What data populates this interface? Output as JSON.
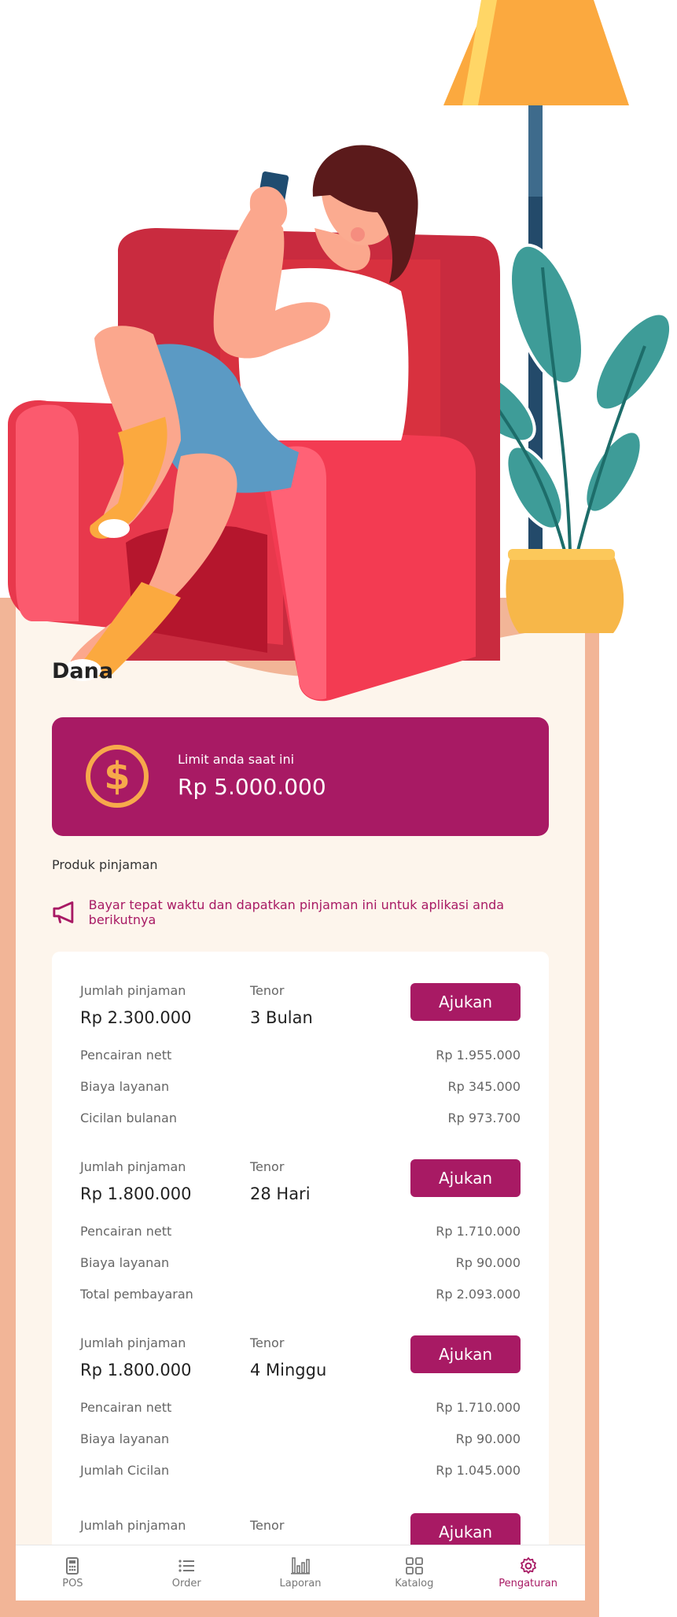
{
  "page": {
    "title": "Dana"
  },
  "limit": {
    "label": "Limit anda saat ini",
    "value": "Rp 5.000.000",
    "icon": "dollar-coin-icon"
  },
  "products": {
    "section_label": "Produk pinjaman",
    "promo_text": "Bayar tepat waktu dan dapatkan pinjaman ini untuk aplikasi anda berikutnya",
    "promo_icon": "megaphone-icon"
  },
  "offers": [
    {
      "amount_label": "Jumlah pinjaman",
      "amount": "Rp 2.300.000",
      "tenor_label": "Tenor",
      "tenor": "3 Bulan",
      "button": "Ajukan",
      "rows": [
        {
          "label": "Pencairan nett",
          "value": "Rp 1.955.000"
        },
        {
          "label": "Biaya layanan",
          "value": "Rp 345.000"
        },
        {
          "label": "Cicilan bulanan",
          "value": "Rp 973.700"
        }
      ]
    },
    {
      "amount_label": "Jumlah pinjaman",
      "amount": "Rp 1.800.000",
      "tenor_label": "Tenor",
      "tenor": "28 Hari",
      "button": "Ajukan",
      "rows": [
        {
          "label": "Pencairan nett",
          "value": "Rp 1.710.000"
        },
        {
          "label": "Biaya layanan",
          "value": "Rp 90.000"
        },
        {
          "label": "Total pembayaran",
          "value": "Rp 2.093.000"
        }
      ]
    },
    {
      "amount_label": "Jumlah pinjaman",
      "amount": "Rp 1.800.000",
      "tenor_label": "Tenor",
      "tenor": "4 Minggu",
      "button": "Ajukan",
      "rows": [
        {
          "label": "Pencairan nett",
          "value": "Rp 1.710.000"
        },
        {
          "label": "Biaya layanan",
          "value": "Rp 90.000"
        },
        {
          "label": "Jumlah Cicilan",
          "value": "Rp 1.045.000"
        }
      ]
    },
    {
      "amount_label": "Jumlah pinjaman",
      "tenor_label": "Tenor",
      "button": "Ajukan"
    }
  ],
  "nav": [
    {
      "label": "POS",
      "icon": "calculator-icon",
      "active": false
    },
    {
      "label": "Order",
      "icon": "list-icon",
      "active": false
    },
    {
      "label": "Laporan",
      "icon": "bar-chart-icon",
      "active": false
    },
    {
      "label": "Katalog",
      "icon": "grid-icon",
      "active": false
    },
    {
      "label": "Pengaturan",
      "icon": "gear-icon",
      "active": true
    }
  ],
  "colors": {
    "accent": "#a81a64",
    "panel": "#fdf5ec",
    "frame": "#f2b597",
    "coin": "#f7a94b"
  }
}
